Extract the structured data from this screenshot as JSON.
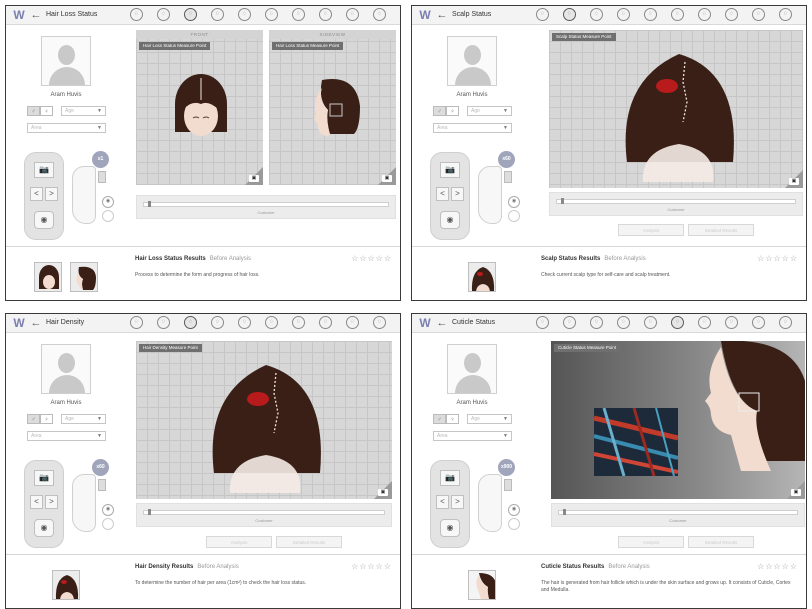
{
  "colors": {
    "accent": "#7a7fb0",
    "hair": "#3a1f17",
    "highlight": "#b81b1b",
    "toolbar": "#f3f3f3"
  },
  "toolbar_icons": [
    "back-arrow-icon",
    "head-icon-1",
    "head-icon-2",
    "hair-loss-icon",
    "head-icon-4",
    "scalp-icon",
    "head-icon-6",
    "head-icon-7",
    "head-icon-8",
    "head-icon-9",
    "head-icon-10"
  ],
  "panels": [
    {
      "title": "Hair Loss Status",
      "user": {
        "name": "Aram Huvis",
        "gender": "♂ ♀",
        "age": "Age",
        "area": "Area"
      },
      "magnification": "x1",
      "views": [
        {
          "head": "FRONT",
          "label": "Hair Loss Status Measure Point"
        },
        {
          "head": "SIDEVIEW",
          "label": "Hair Loss Status Measure Point"
        }
      ],
      "slider_label": "Customer",
      "buttons": [
        "",
        ""
      ],
      "result_title": "Hair Loss Status Results",
      "result_status": "Before Analysis",
      "result_desc": "Process to determine the form and progress of hair loss.",
      "stars": "☆☆☆☆☆"
    },
    {
      "title": "Scalp Status",
      "user": {
        "name": "Aram Huvis",
        "gender": "♂ ♀",
        "age": "Age",
        "area": "Area"
      },
      "magnification": "x60",
      "views": [
        {
          "head": "",
          "label": "Scalp Status Measure Point"
        }
      ],
      "slider_label": "Customer",
      "buttons": [
        "Analysis",
        "Detailed Results"
      ],
      "result_title": "Scalp Status Results",
      "result_status": "Before Analysis",
      "result_desc": "Check current scalp type for self-care and scalp treatment.",
      "stars": "☆☆☆☆☆"
    },
    {
      "title": "Hair Density",
      "user": {
        "name": "Aram Huvis",
        "gender": "♂ ♀",
        "age": "Age",
        "area": "Area"
      },
      "magnification": "x60",
      "views": [
        {
          "head": "",
          "label": "Hair Density Measure Point"
        }
      ],
      "slider_label": "Customer",
      "buttons": [
        "Analysis",
        "Detailed Results"
      ],
      "result_title": "Hair Density Results",
      "result_status": "Before Analysis",
      "result_desc": "To determine the number of hair per area (1cm²) to check the hair loss status.",
      "stars": "☆☆☆☆☆"
    },
    {
      "title": "Cuticle Status",
      "user": {
        "name": "Aram Huvis",
        "gender": "♂ ♀",
        "age": "Age",
        "area": "Area"
      },
      "magnification": "x900",
      "views": [
        {
          "head": "",
          "label": "Cuticle Status Measure Point"
        }
      ],
      "slider_label": "Customer",
      "buttons": [
        "Analysis",
        "Detailed Results"
      ],
      "result_title": "Cuticle Status Results",
      "result_status": "Before Analysis",
      "result_desc": "The hair is generated from hair follicle which is under the skin surface and grows up. It consists of Cuticle, Cortex and Medulla.",
      "stars": "☆☆☆☆☆"
    }
  ]
}
